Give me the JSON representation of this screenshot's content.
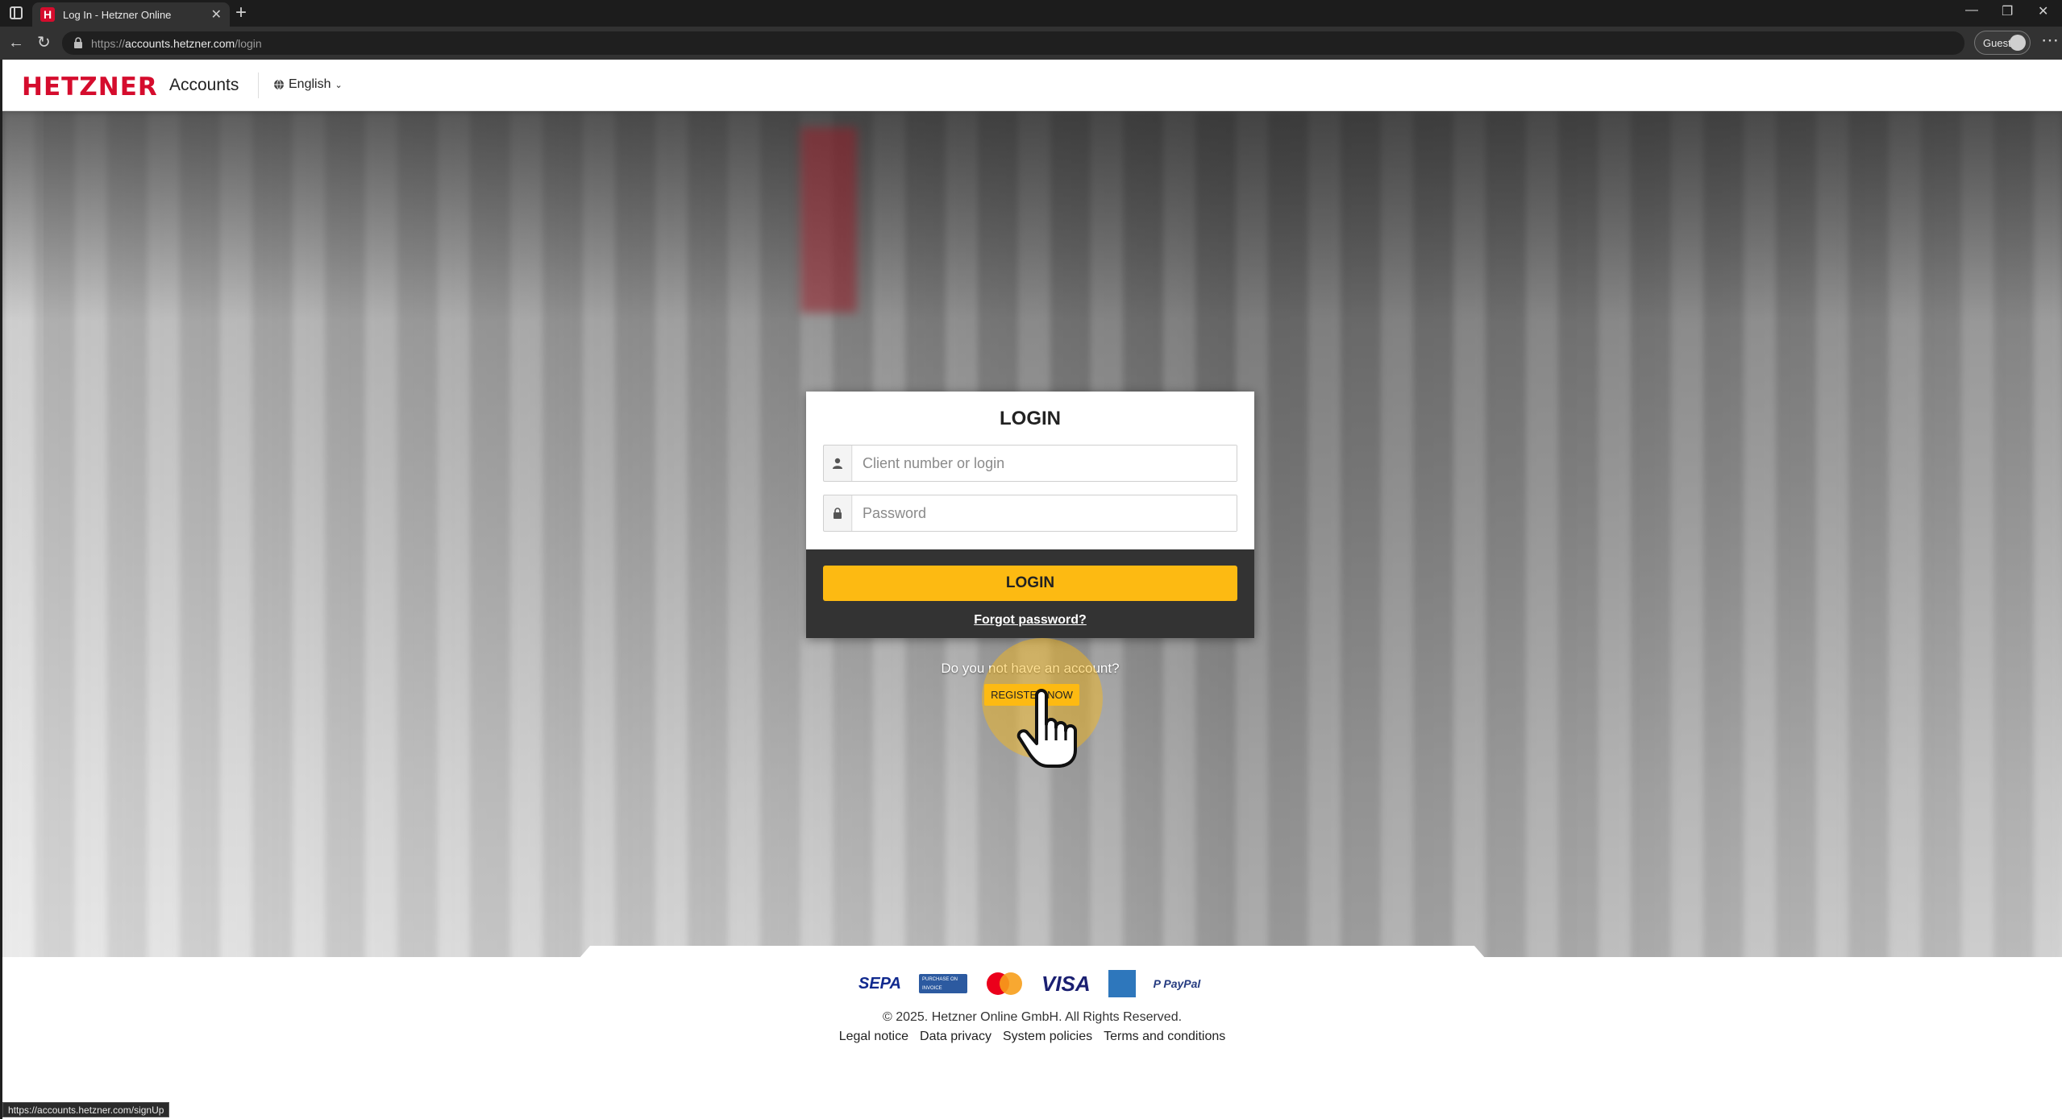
{
  "browser": {
    "tab_title": "Log In - Hetzner Online",
    "favicon_letter": "H",
    "url_prefix": "https://",
    "url_host": "accounts.hetzner.com",
    "url_path": "/login",
    "profile_label": "Guest",
    "status_url": "https://accounts.hetzner.com/signUp"
  },
  "header": {
    "logo": "HETZNER",
    "section": "Accounts",
    "language": "English"
  },
  "login": {
    "title": "LOGIN",
    "username_placeholder": "Client number or login",
    "password_placeholder": "Password",
    "submit_label": "LOGIN",
    "forgot_label": "Forgot password?",
    "no_account_text": "Do you not have an account?",
    "register_label": "REGISTER NOW"
  },
  "footer": {
    "payment_methods": {
      "sepa": "SEPA",
      "invoice": "PURCHASE ON INVOICE",
      "visa": "VISA",
      "paypal": "P PayPal"
    },
    "copyright": "© 2025. Hetzner Online GmbH. All Rights Reserved.",
    "links": [
      "Legal notice",
      "Data privacy",
      "System policies",
      "Terms and conditions"
    ]
  },
  "colors": {
    "brand_red": "#d50c2d",
    "accent_yellow": "#fdba12",
    "card_dark": "#333333"
  }
}
